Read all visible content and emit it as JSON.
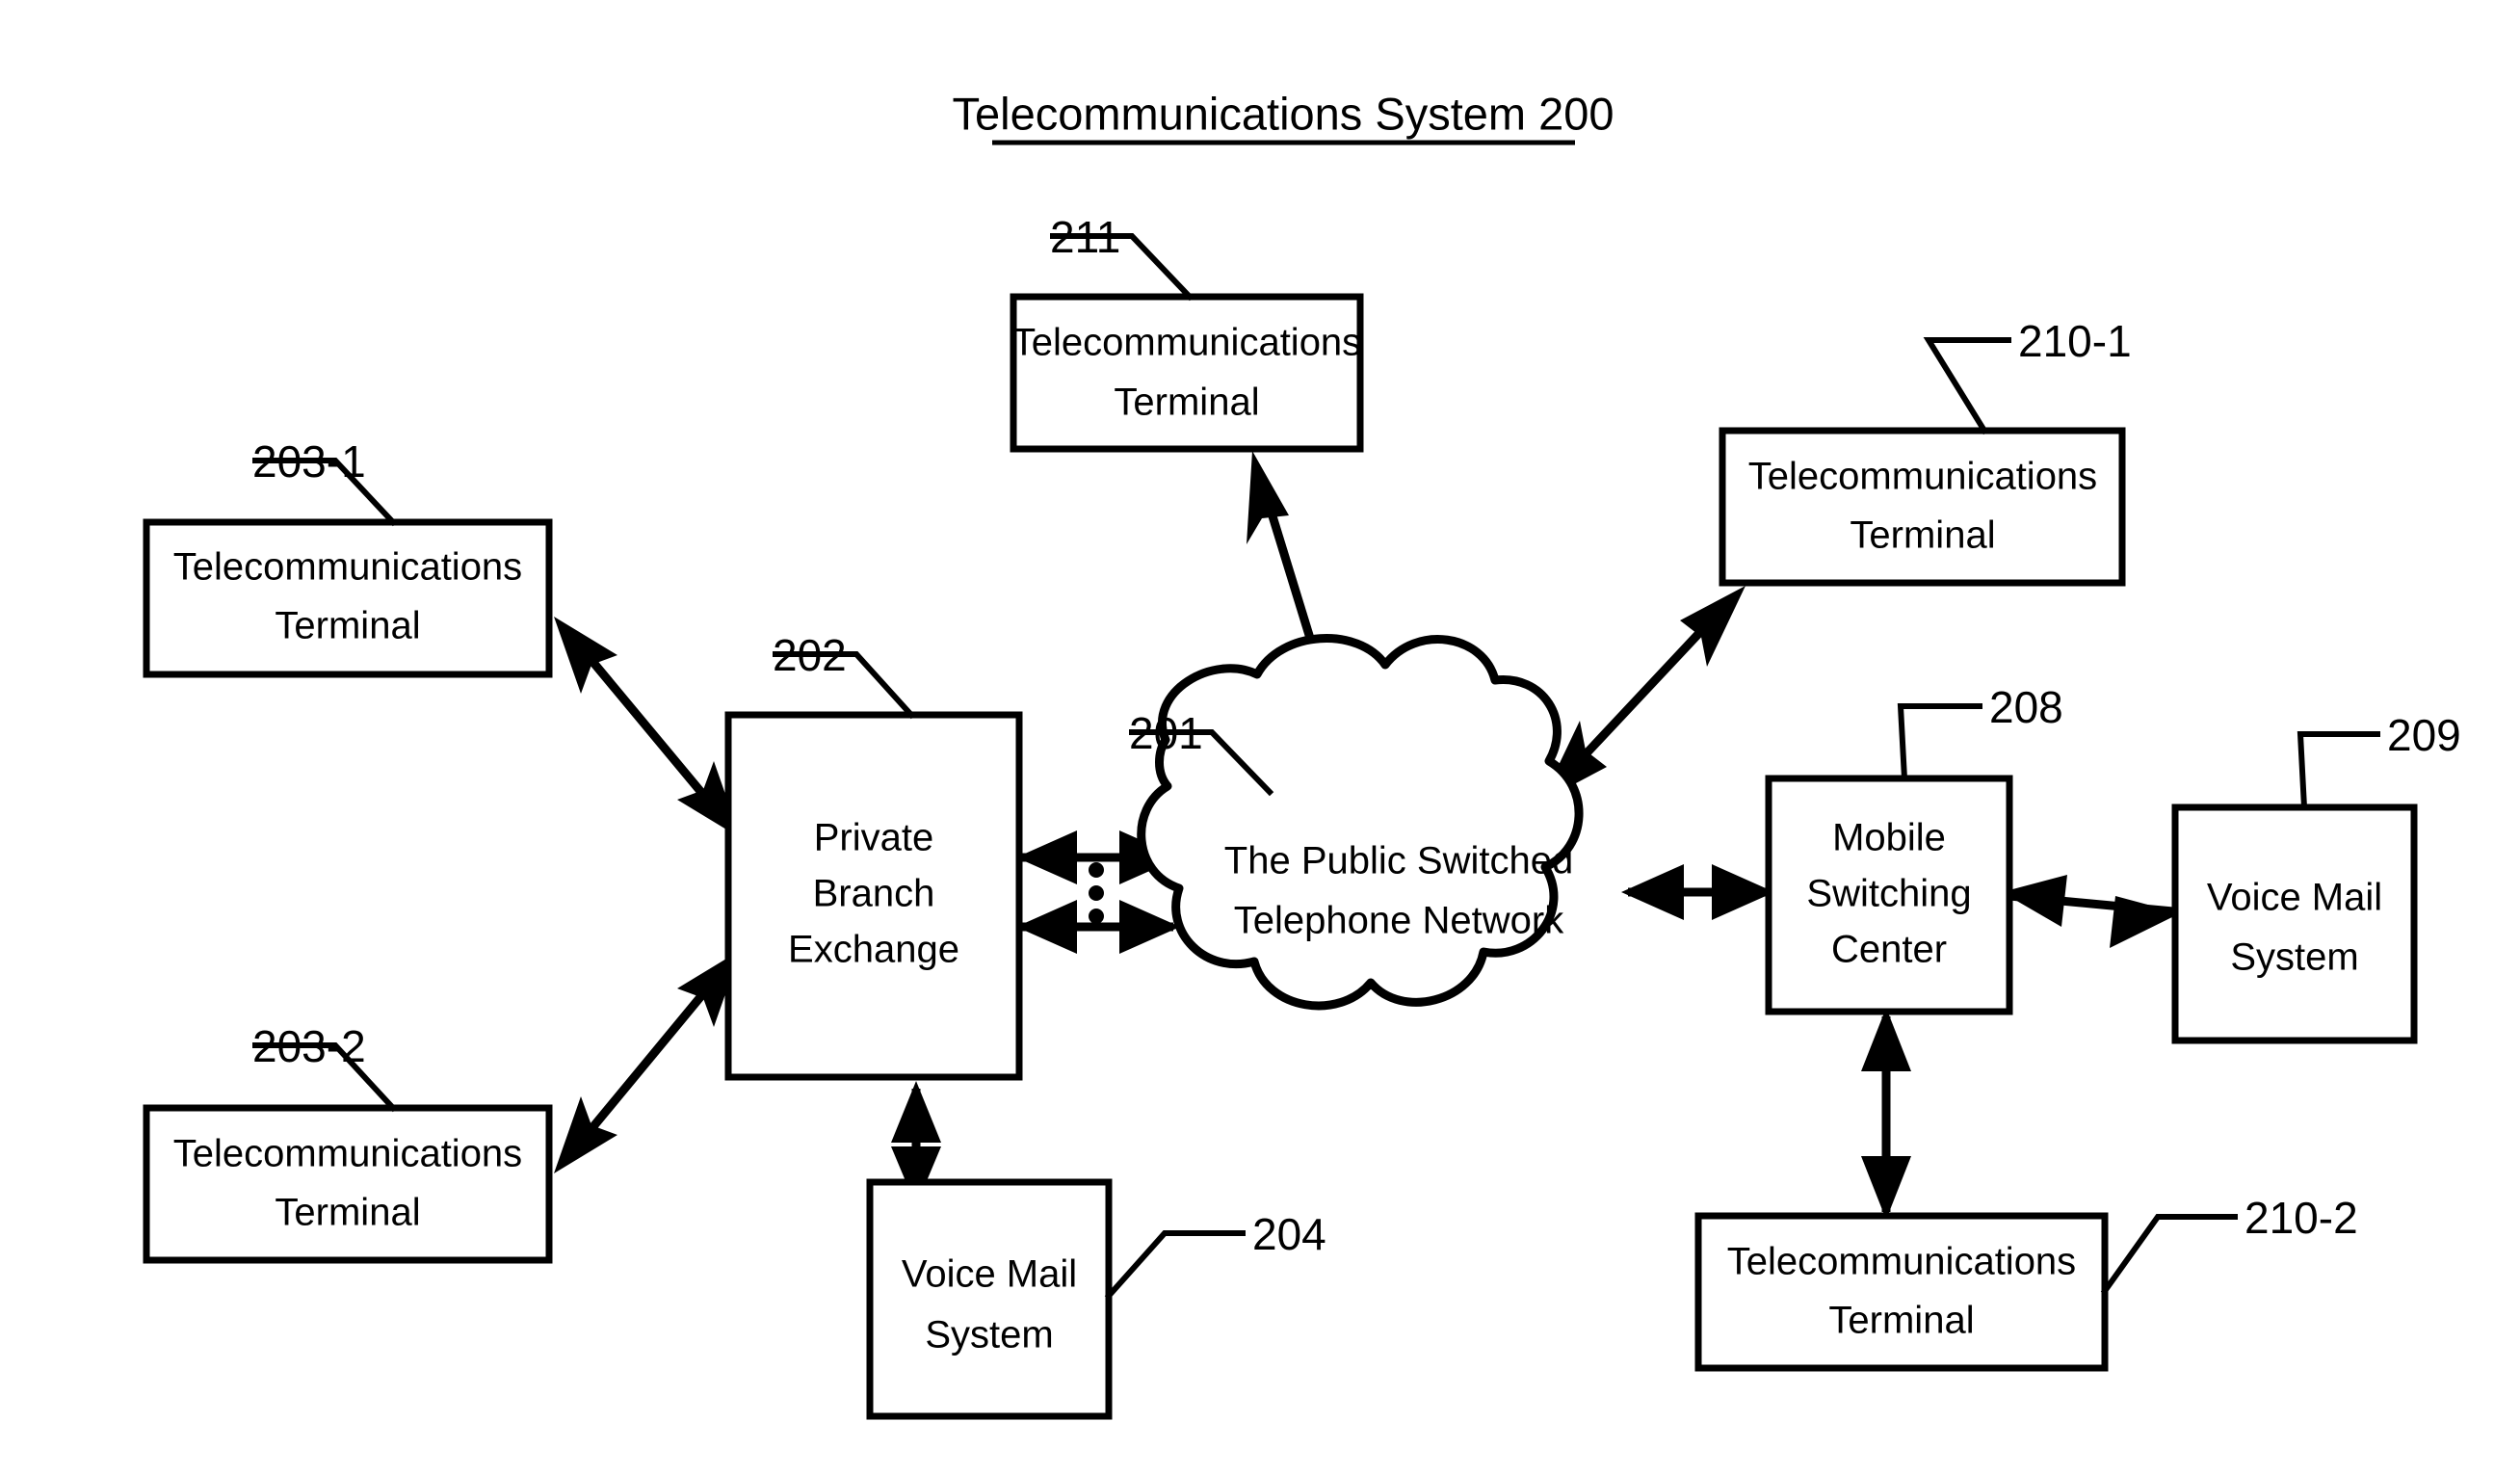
{
  "figure": {
    "title": "Telecommunications System 200",
    "background_color": "#ffffff",
    "line_color": "#000000"
  },
  "nodes": {
    "pstn": {
      "ref": "201",
      "label_line1": "The Public Switched",
      "label_line2": "Telephone Network",
      "shape": "cloud"
    },
    "pbx": {
      "ref": "202",
      "label_line1": "Private",
      "label_line2": "Branch",
      "label_line3": "Exchange",
      "shape": "rect"
    },
    "terminal_203_1": {
      "ref": "203-1",
      "label_line1": "Telecommunications",
      "label_line2": "Terminal",
      "shape": "rect"
    },
    "terminal_203_2": {
      "ref": "203-2",
      "label_line1": "Telecommunications",
      "label_line2": "Terminal",
      "shape": "rect"
    },
    "voicemail_204": {
      "ref": "204",
      "label_line1": "Voice Mail",
      "label_line2": "System",
      "shape": "rect"
    },
    "msc_208": {
      "ref": "208",
      "label_line1": "Mobile",
      "label_line2": "Switching",
      "label_line3": "Center",
      "shape": "rect"
    },
    "voicemail_209": {
      "ref": "209",
      "label_line1": "Voice Mail",
      "label_line2": "System",
      "shape": "rect"
    },
    "terminal_210_1": {
      "ref": "210-1",
      "label_line1": "Telecommunications",
      "label_line2": "Terminal",
      "shape": "rect"
    },
    "terminal_210_2": {
      "ref": "210-2",
      "label_line1": "Telecommunications",
      "label_line2": "Terminal",
      "shape": "rect"
    },
    "terminal_211": {
      "ref": "211",
      "label_line1": "Telecommunications",
      "label_line2": "Terminal",
      "shape": "rect"
    }
  },
  "connections": [
    {
      "from": "terminal_203_1",
      "to": "pbx",
      "style": "double-arrow"
    },
    {
      "from": "terminal_203_2",
      "to": "pbx",
      "style": "double-arrow"
    },
    {
      "from": "pbx",
      "to": "pstn",
      "style": "double-arrow-upper"
    },
    {
      "from": "pbx",
      "to": "pstn",
      "style": "double-arrow-lower"
    },
    {
      "from": "pbx",
      "to": "voicemail_204",
      "style": "double-arrow"
    },
    {
      "from": "terminal_211",
      "to": "pstn",
      "style": "double-arrow"
    },
    {
      "from": "pstn",
      "to": "terminal_210_1",
      "style": "double-arrow"
    },
    {
      "from": "pstn",
      "to": "msc_208",
      "style": "double-arrow"
    },
    {
      "from": "msc_208",
      "to": "voicemail_209",
      "style": "double-arrow"
    },
    {
      "from": "msc_208",
      "to": "terminal_210_2",
      "style": "double-arrow"
    }
  ],
  "trunk_ellipsis": {
    "dot_count": 3
  }
}
